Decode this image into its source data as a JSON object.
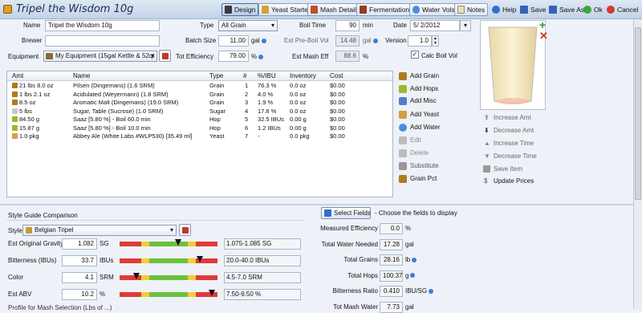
{
  "window": {
    "title": "Tripel the Wisdom 10g"
  },
  "toolbar": {
    "tabs": [
      "Design",
      "Yeast Starter",
      "Mash Details",
      "Fermentation",
      "Water Vols",
      "Notes"
    ],
    "actions": [
      "Help",
      "Save",
      "Save As",
      "Ok",
      "Cancel"
    ]
  },
  "form": {
    "name_label": "Name",
    "name_value": "Tripel the Wisdom 10g",
    "brewer_label": "Brewer",
    "brewer_value": "",
    "equipment_label": "Equipment",
    "equipment_value": "My Equipment (15gal Kettle & 52qt Co",
    "type_label": "Type",
    "type_value": "All Grain",
    "batch_label": "Batch Size",
    "batch_value": "11.00",
    "batch_unit": "gal",
    "eff_label": "Tot Efficiency",
    "eff_value": "79.00",
    "eff_unit": "%",
    "boil_label": "Boil Time",
    "boil_value": "90",
    "boil_unit": "min",
    "preboil_label": "Est Pre-Boil Vol",
    "preboil_value": "14.48",
    "preboil_unit": "gal",
    "mash_label": "Est Mash Eff",
    "mash_value": "88.6",
    "mash_unit": "%",
    "date_label": "Date",
    "date_value": "5/  2/2012",
    "version_label": "Version",
    "version_value": "1.0",
    "calc_label": "Calc Boil Vol"
  },
  "grid": {
    "headers": [
      "Amt",
      "Name",
      "Type",
      "#",
      "%/IBU",
      "Inventory",
      "Cost"
    ],
    "rows": [
      {
        "amt": "21 lbs 8.0 oz",
        "name": "Pilsen (Dingemans) (1.6 SRM)",
        "type": "Grain",
        "num": "1",
        "pct": "76.3 %",
        "inv": "0.0 oz",
        "cost": "$0.00",
        "color": "#b07a1e"
      },
      {
        "amt": "1 lbs 2.1 oz",
        "name": "Acidulated (Weyermann) (1.8 SRM)",
        "type": "Grain",
        "num": "2",
        "pct": "4.0 %",
        "inv": "0.0 oz",
        "cost": "$0.00",
        "color": "#b07a1e"
      },
      {
        "amt": "8.5 oz",
        "name": "Aromatic Malt (Dingemans) (19.0 SRM)",
        "type": "Grain",
        "num": "3",
        "pct": "1.9 %",
        "inv": "0.0 oz",
        "cost": "$0.00",
        "color": "#b07a1e"
      },
      {
        "amt": "5 lbs",
        "name": "Sugar, Table (Sucrose) (1.0 SRM)",
        "type": "Sugar",
        "num": "4",
        "pct": "17.8 %",
        "inv": "0.0 oz",
        "cost": "$0.00",
        "color": "#c8c8c8"
      },
      {
        "amt": "84.50 g",
        "name": "Saaz [5.80 %] - Boil 60.0 min",
        "type": "Hop",
        "num": "5",
        "pct": "32.5 IBUs",
        "inv": "0.00 g",
        "cost": "$0.00",
        "color": "#9ab830"
      },
      {
        "amt": "15.87 g",
        "name": "Saaz [5.80 %] - Boil 10.0 min",
        "type": "Hop",
        "num": "6",
        "pct": "1.2 IBUs",
        "inv": "0.00 g",
        "cost": "$0.00",
        "color": "#9ab830"
      },
      {
        "amt": "1.0 pkg",
        "name": "Abbey Ale (White Labs #WLP530) [35.49 ml]",
        "type": "Yeast",
        "num": "7",
        "pct": "-",
        "inv": "0.0 pkg",
        "cost": "$0.00",
        "color": "#d4a040"
      }
    ]
  },
  "side_actions": [
    "Add Grain",
    "Add Hops",
    "Add Misc",
    "Add Yeast",
    "Add Water",
    "Edit",
    "Delete",
    "Substitute",
    "Grain Pct"
  ],
  "adjust_actions": [
    "Increase Amt",
    "Decrease Amt",
    "Increase Time",
    "Decrease Time",
    "Save Item",
    "Update Prices"
  ],
  "style_guide": {
    "title": "Style Guide Comparison",
    "style_label": "Style",
    "style_value": "Belgian Tripel",
    "rows": [
      {
        "label": "Est Original Gravity",
        "value": "1.082",
        "unit": "SG",
        "range": "1.075-1.085 SG",
        "marker": 0.6
      },
      {
        "label": "Bitterness (IBUs)",
        "value": "33.7",
        "unit": "IBUs",
        "range": "20.0-40.0 IBUs",
        "marker": 0.82
      },
      {
        "label": "Color",
        "value": "4.1",
        "unit": "SRM",
        "range": "4.5-7.0 SRM",
        "marker": 0.17
      },
      {
        "label": "Est ABV",
        "value": "10.2",
        "unit": "%",
        "range": "7.50-9.50 %",
        "marker": 0.94
      }
    ],
    "footer": "Profile for Mash Selection (Lbs of ...)"
  },
  "fields_panel": {
    "button": "Select Fields",
    "hint": "- Choose the fields to display",
    "rows": [
      {
        "label": "Measured Efficiency",
        "value": "0.0",
        "unit": "%"
      },
      {
        "label": "Total Water Needed",
        "value": "17.28",
        "unit": "gal"
      },
      {
        "label": "Total Grains",
        "value": "28.16",
        "unit": "lb"
      },
      {
        "label": "Total Hops",
        "value": "100.37",
        "unit": "g"
      },
      {
        "label": "Bitterness Ratio",
        "value": "0.410",
        "unit": "IBU/SG"
      },
      {
        "label": "Tot Mash Water",
        "value": "7.73",
        "unit": "gal"
      }
    ]
  }
}
